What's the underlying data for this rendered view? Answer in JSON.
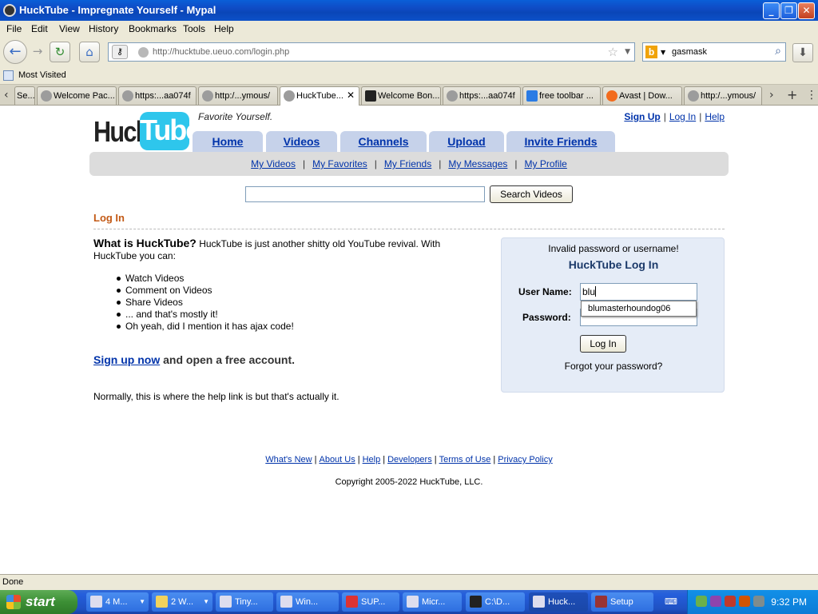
{
  "window": {
    "title": "HuckTube - Impregnate Yourself - Mypal",
    "minimize": "_",
    "maximize": "❐",
    "close": "✕"
  },
  "menu": [
    "File",
    "Edit",
    "View",
    "History",
    "Bookmarks",
    "Tools",
    "Help"
  ],
  "nav": {
    "url": "http://hucktube.ueuo.com/login.php",
    "search_engine": "b",
    "search_query": "gasmask"
  },
  "bookmarks": {
    "label": "Most Visited"
  },
  "tabs": [
    {
      "label": "Se..."
    },
    {
      "label": "Welcome Pac..."
    },
    {
      "label": "https:...aa074f"
    },
    {
      "label": "http:/...ymous/"
    },
    {
      "label": "HuckTube..."
    },
    {
      "label": "Welcome Bon..."
    },
    {
      "label": "https:...aa074f"
    },
    {
      "label": "free toolbar ..."
    },
    {
      "label": "Avast | Dow..."
    },
    {
      "label": "http:/...ymous/"
    }
  ],
  "site": {
    "logo_huck": "Huck",
    "logo_tube": "Tube",
    "tagline": "Favorite Yourself.",
    "top_links": {
      "signup": "Sign Up",
      "login": "Log In",
      "help": "Help",
      "sep": "|"
    },
    "main_tabs": [
      "Home",
      "Videos",
      "Channels",
      "Upload",
      "Invite Friends"
    ],
    "sub_nav": [
      "My Videos",
      "My Favorites",
      "My Friends",
      "My Messages",
      "My Profile"
    ],
    "search_button": "Search Videos",
    "login_heading": "Log In",
    "about_question": "What is HuckTube?",
    "about_text": " HuckTube is just another shitty old YouTube revival. With HuckTube you can:",
    "features": [
      "Watch Videos",
      "Comment on Videos",
      "Share Videos",
      "... and that's mostly it!",
      "Oh yeah, did I mention it has ajax code!"
    ],
    "signup_link": "Sign up now",
    "signup_text": " and open a free account.",
    "help_note": "Normally, this is where the help link is but that's actually it.",
    "login_box": {
      "error": "Invalid password or username!",
      "title": "HuckTube Log In",
      "username_label": "User Name:",
      "username_value": "blu",
      "password_label": "Password:",
      "login_button": "Log In",
      "forgot": "Forgot your password?",
      "autocomplete": "blumasterhoundog06"
    },
    "footer_links": [
      "What's New",
      "About Us",
      "Help",
      "Developers",
      "Terms of Use",
      "Privacy Policy"
    ],
    "copyright": "Copyright 2005-2022 HuckTube, LLC."
  },
  "status": "Done",
  "taskbar": {
    "start": "start",
    "buttons": [
      {
        "label": "4 M..."
      },
      {
        "label": "2 W..."
      },
      {
        "label": "Tiny..."
      },
      {
        "label": "Win..."
      },
      {
        "label": "SUP..."
      },
      {
        "label": "Micr..."
      },
      {
        "label": "C:\\D..."
      },
      {
        "label": "Huck..."
      },
      {
        "label": "Setup"
      }
    ],
    "clock": "9:32 PM"
  }
}
